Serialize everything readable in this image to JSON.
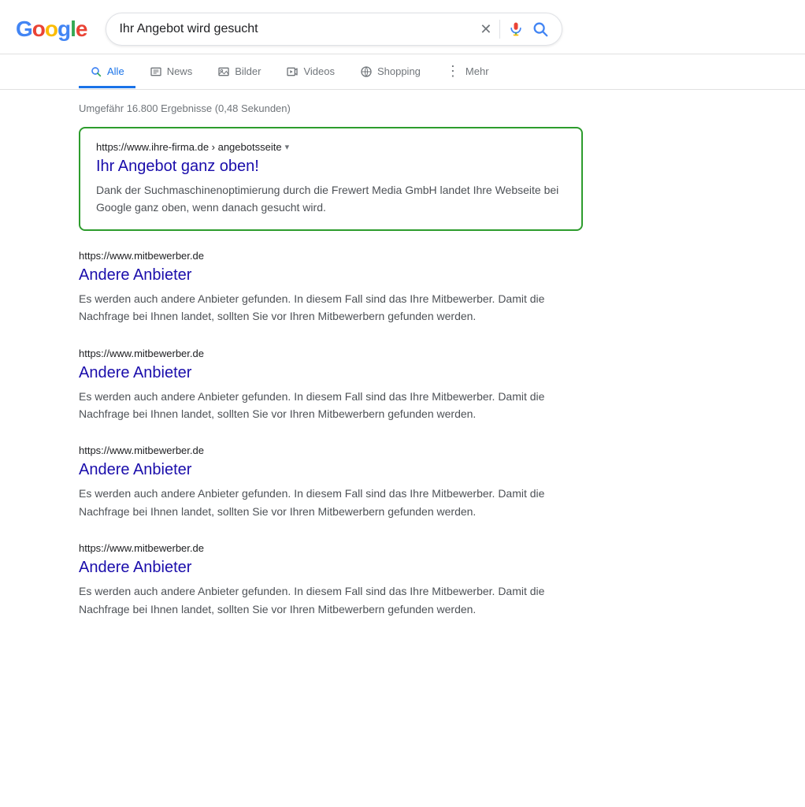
{
  "header": {
    "logo_letters": [
      {
        "letter": "G",
        "color_class": "g-blue"
      },
      {
        "letter": "o",
        "color_class": "g-red"
      },
      {
        "letter": "o",
        "color_class": "g-yellow"
      },
      {
        "letter": "g",
        "color_class": "g-blue"
      },
      {
        "letter": "l",
        "color_class": "g-green"
      },
      {
        "letter": "e",
        "color_class": "g-red"
      }
    ],
    "search_query": "Ihr Angebot wird gesucht",
    "clear_button_label": "✕"
  },
  "nav": {
    "tabs": [
      {
        "id": "alle",
        "label": "Alle",
        "active": true,
        "icon": "🔍"
      },
      {
        "id": "news",
        "label": "News",
        "active": false,
        "icon": "📰"
      },
      {
        "id": "bilder",
        "label": "Bilder",
        "active": false,
        "icon": "🖼"
      },
      {
        "id": "videos",
        "label": "Videos",
        "active": false,
        "icon": "▶"
      },
      {
        "id": "shopping",
        "label": "Shopping",
        "active": false,
        "icon": "🏷"
      },
      {
        "id": "mehr",
        "label": "Mehr",
        "active": false,
        "icon": "⋮"
      }
    ]
  },
  "results": {
    "count_text": "Umgefähr 16.800 Ergebnisse (0,48 Sekunden)",
    "featured": {
      "url": "https://www.ihre-firma.de › angebotsseite",
      "title": "Ihr Angebot ganz oben!",
      "description": "Dank der Suchmaschinenoptimierung durch die Frewert Media GmbH landet Ihre Webseite bei Google ganz oben, wenn danach gesucht wird."
    },
    "items": [
      {
        "url": "https://www.mitbewerber.de",
        "title": "Andere Anbieter",
        "description": "Es werden auch andere Anbieter gefunden. In diesem Fall sind das Ihre Mitbewerber. Damit die Nachfrage bei Ihnen landet, sollten Sie vor Ihren Mitbewerbern gefunden werden."
      },
      {
        "url": "https://www.mitbewerber.de",
        "title": "Andere Anbieter",
        "description": "Es werden auch andere Anbieter gefunden. In diesem Fall sind das Ihre Mitbewerber. Damit die Nachfrage bei Ihnen landet, sollten Sie vor Ihren Mitbewerbern gefunden werden."
      },
      {
        "url": "https://www.mitbewerber.de",
        "title": "Andere Anbieter",
        "description": "Es werden auch andere Anbieter gefunden. In diesem Fall sind das Ihre Mitbewerber. Damit die Nachfrage bei Ihnen landet, sollten Sie vor Ihren Mitbewerbern gefunden werden."
      },
      {
        "url": "https://www.mitbewerber.de",
        "title": "Andere Anbieter",
        "description": "Es werden auch andere Anbieter gefunden. In diesem Fall sind das Ihre Mitbewerber. Damit die Nachfrage bei Ihnen landet, sollten Sie vor Ihren Mitbewerbern gefunden werden."
      }
    ]
  }
}
